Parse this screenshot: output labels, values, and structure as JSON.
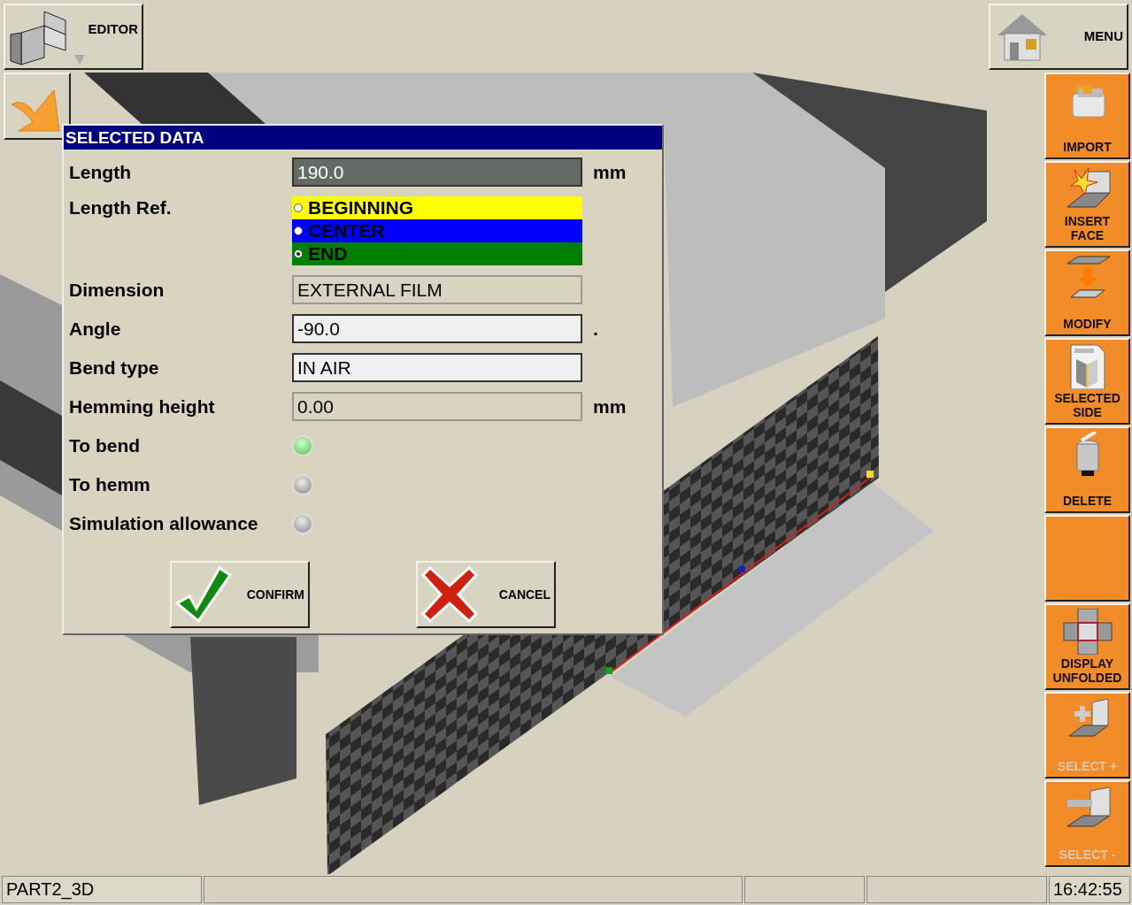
{
  "toolbar": {
    "editor": {
      "label": "EDITOR"
    },
    "menu": {
      "label": "MENU"
    }
  },
  "dialog": {
    "title": "SELECTED DATA",
    "rows": [
      {
        "kind": "field",
        "label": "Length",
        "value": "190.0",
        "unit": "mm",
        "highlighted": true,
        "readonly": false
      },
      {
        "kind": "radio",
        "label": "Length Ref.",
        "options": [
          {
            "label": "BEGINNING",
            "color": "#ffff00",
            "selected": false
          },
          {
            "label": "CENTER",
            "color": "#0000ff",
            "selected": false
          },
          {
            "label": "END",
            "color": "#008000",
            "selected": true
          }
        ]
      },
      {
        "kind": "field",
        "label": "Dimension",
        "value": "EXTERNAL FILM",
        "highlighted": false,
        "readonly": true
      },
      {
        "kind": "field",
        "label": "Angle",
        "value": "-90.0",
        "unit": ".",
        "highlighted": false,
        "readonly": false
      },
      {
        "kind": "field",
        "label": "Bend type",
        "value": "IN AIR",
        "highlighted": false,
        "readonly": false
      },
      {
        "kind": "field",
        "label": "Hemming height",
        "value": "0.00",
        "unit": "mm",
        "highlighted": false,
        "readonly": true
      },
      {
        "kind": "led",
        "label": "To bend",
        "on": true
      },
      {
        "kind": "led",
        "label": "To hemm",
        "on": false
      },
      {
        "kind": "led",
        "label": "Simulation allowance",
        "on": false
      }
    ],
    "buttons": [
      {
        "kind": "confirm",
        "label": "CONFIRM"
      },
      {
        "kind": "cancel",
        "label": "CANCEL"
      }
    ]
  },
  "sidebar": [
    {
      "kind": "import",
      "label": "IMPORT",
      "disabled": false
    },
    {
      "kind": "insert",
      "label": "INSERT FACE",
      "disabled": false
    },
    {
      "kind": "modify",
      "label": "MODIFY",
      "disabled": false
    },
    {
      "kind": "side",
      "label": "SELECTED SIDE",
      "disabled": false
    },
    {
      "kind": "delete",
      "label": "DELETE",
      "disabled": false
    },
    {
      "kind": "blank"
    },
    {
      "kind": "unfold",
      "label": "DISPLAY UNFOLDED",
      "disabled": false
    },
    {
      "kind": "selectplus",
      "label": "SELECT +",
      "disabled": true
    },
    {
      "kind": "selectminus",
      "label": "SELECT -",
      "disabled": true
    }
  ],
  "status_bar": {
    "part": "PART2_3D",
    "clock": "16:42:55"
  }
}
